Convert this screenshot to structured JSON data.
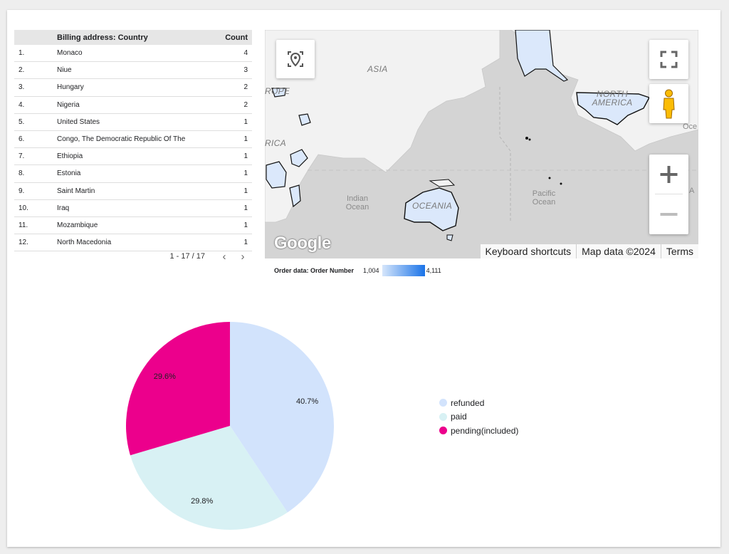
{
  "table": {
    "headers": {
      "name": "Billing address: Country",
      "count": "Count"
    },
    "rows": [
      {
        "idx": "1.",
        "name": "Monaco",
        "count": "4"
      },
      {
        "idx": "2.",
        "name": "Niue",
        "count": "3"
      },
      {
        "idx": "3.",
        "name": "Hungary",
        "count": "2"
      },
      {
        "idx": "4.",
        "name": "Nigeria",
        "count": "2"
      },
      {
        "idx": "5.",
        "name": "United States",
        "count": "1"
      },
      {
        "idx": "6.",
        "name": "Congo, The Democratic Republic Of The",
        "count": "1"
      },
      {
        "idx": "7.",
        "name": "Ethiopia",
        "count": "1"
      },
      {
        "idx": "8.",
        "name": "Estonia",
        "count": "1"
      },
      {
        "idx": "9.",
        "name": "Saint Martin",
        "count": "1"
      },
      {
        "idx": "10.",
        "name": "Iraq",
        "count": "1"
      },
      {
        "idx": "11.",
        "name": "Mozambique",
        "count": "1"
      },
      {
        "idx": "12.",
        "name": "North Macedonia",
        "count": "1"
      }
    ],
    "pagination": "1 - 17 / 17",
    "prev_icon": "chevron-left-icon",
    "next_icon": "chevron-right-icon"
  },
  "map": {
    "labels": {
      "asia": "ASIA",
      "rope": "ROPE",
      "rica": "RICA",
      "north_america": "NORTH AMERICA",
      "oceania": "OCEANIA",
      "indian_ocean": "Indian Ocean",
      "pacific_ocean": "Pacific Ocean",
      "a": "A",
      "oce": "Oce"
    },
    "logo": "Google",
    "footer": {
      "shortcuts": "Keyboard shortcuts",
      "data": "Map data ©2024",
      "terms": "Terms"
    },
    "controls": [
      "location-icon",
      "fullscreen-icon",
      "pegman-icon",
      "zoom-in-icon",
      "zoom-out-icon"
    ],
    "colors": {
      "land": "#f2f2f2",
      "ocean": "#d4d4d4",
      "highlight": "#dbe8fb"
    }
  },
  "map_legend": {
    "title": "Order data: Order Number",
    "min": "1,004",
    "max": "4,111",
    "color_min": "#d6e6fb",
    "color_max": "#1a73e8"
  },
  "chart_data": {
    "type": "pie",
    "slices": [
      {
        "name": "refunded",
        "value": 40.7,
        "label": "40.7%",
        "color": "#d2e3fc"
      },
      {
        "name": "paid",
        "value": 29.8,
        "label": "29.8%",
        "color": "#d8f1f4"
      },
      {
        "name": "pending(included)",
        "value": 29.6,
        "label": "29.6%",
        "color": "#ec008c"
      }
    ],
    "legend": [
      "refunded",
      "paid",
      "pending(included)"
    ],
    "legend_position": "right"
  }
}
